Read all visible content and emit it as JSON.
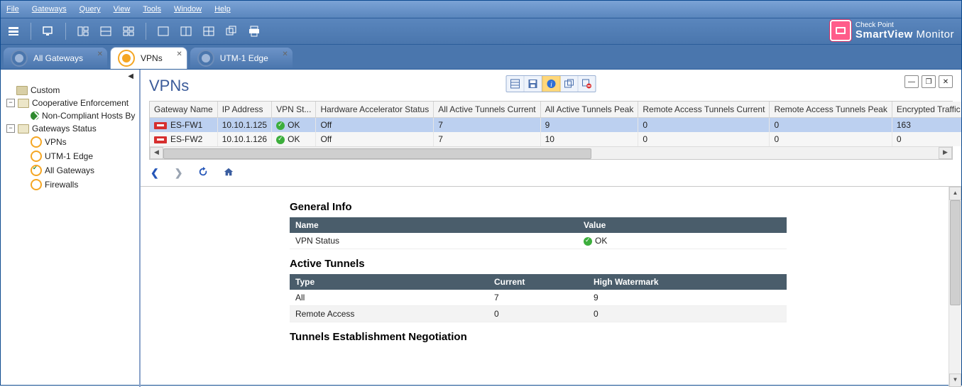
{
  "menubar": [
    "File",
    "Gateways",
    "Query",
    "View",
    "Tools",
    "Window",
    "Help"
  ],
  "brand": {
    "line1": "Check Point",
    "line2_a": "SmartView",
    "line2_b": " Monitor"
  },
  "tabs": [
    {
      "label": "All Gateways",
      "active": false
    },
    {
      "label": "VPNs",
      "active": true
    },
    {
      "label": "UTM-1 Edge",
      "active": false
    }
  ],
  "sidebar": {
    "root": [
      {
        "type": "folder",
        "label": "Custom",
        "open": false
      },
      {
        "type": "branch",
        "label": "Cooperative Enforcement",
        "open": true,
        "icon": "fld",
        "children": [
          {
            "label": "Non-Compliant Hosts By",
            "icon": "non"
          }
        ]
      },
      {
        "type": "branch",
        "label": "Gateways Status",
        "open": true,
        "icon": "fld",
        "children": [
          {
            "label": "VPNs",
            "icon": "vpn"
          },
          {
            "label": "UTM-1 Edge",
            "icon": "vpn"
          },
          {
            "label": "All Gateways",
            "icon": "all"
          },
          {
            "label": "Firewalls",
            "icon": "vpn"
          }
        ]
      }
    ]
  },
  "page_title": "VPNs",
  "table": {
    "columns": [
      "Gateway Name",
      "IP Address",
      "VPN St...",
      "Hardware Accelerator Status",
      "All Active Tunnels Current",
      "All Active Tunnels Peak",
      "Remote Access Tunnels Current",
      "Remote Access Tunnels Peak",
      "Encrypted Traffic Throughput C"
    ],
    "rows": [
      {
        "selected": true,
        "name": "ES-FW1",
        "ip": "10.10.1.125",
        "vpn": "OK",
        "hw": "Off",
        "actCur": "7",
        "actPeak": "9",
        "raCur": "0",
        "raPeak": "0",
        "enc": "163"
      },
      {
        "selected": false,
        "name": "ES-FW2",
        "ip": "10.10.1.126",
        "vpn": "OK",
        "hw": "Off",
        "actCur": "7",
        "actPeak": "10",
        "raCur": "0",
        "raPeak": "0",
        "enc": "0"
      }
    ]
  },
  "detail": {
    "general": {
      "heading": "General Info",
      "headers": [
        "Name",
        "Value"
      ],
      "rows": [
        {
          "name": "VPN Status",
          "value": "OK",
          "ok": true
        }
      ]
    },
    "active": {
      "heading": "Active Tunnels",
      "headers": [
        "Type",
        "Current",
        "High Watermark"
      ],
      "rows": [
        {
          "type": "All",
          "cur": "7",
          "hw": "9"
        },
        {
          "type": "Remote Access",
          "cur": "0",
          "hw": "0"
        }
      ]
    },
    "next_heading": "Tunnels Establishment Negotiation"
  }
}
